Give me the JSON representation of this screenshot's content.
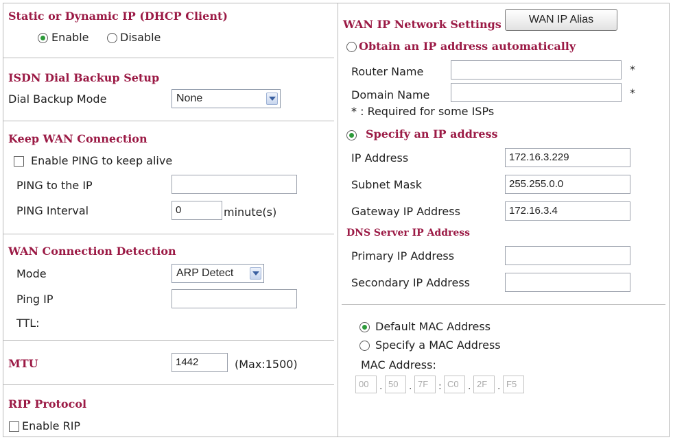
{
  "left": {
    "static_dynamic": {
      "title": "Static or Dynamic IP (DHCP Client)",
      "enable_label": "Enable",
      "disable_label": "Disable",
      "selected": "Enable"
    },
    "isdn": {
      "title": "ISDN Dial Backup Setup",
      "mode_label": "Dial Backup Mode",
      "mode_value": "None"
    },
    "keep_wan": {
      "title": "Keep WAN Connection",
      "ping_checkbox_label": "Enable PING to keep alive",
      "ping_ip_label": "PING to the IP",
      "ping_ip_value": "",
      "ping_interval_label": "PING Interval",
      "ping_interval_value": "0",
      "ping_interval_unit": "minute(s)"
    },
    "detection": {
      "title": "WAN Connection Detection",
      "mode_label": "Mode",
      "mode_value": "ARP Detect",
      "ping_ip_label": "Ping IP",
      "ping_ip_value": "",
      "ttl_label": "TTL:"
    },
    "mtu": {
      "title": "MTU",
      "value": "1442",
      "max_text": "(Max:1500)"
    },
    "rip": {
      "title": "RIP Protocol",
      "checkbox_label": "Enable RIP"
    }
  },
  "right": {
    "wan_ip": {
      "title": "WAN IP Network Settings",
      "alias_button": "WAN IP Alias"
    },
    "obtain": {
      "label": "Obtain an IP address automatically",
      "router_name_label": "Router Name",
      "router_name_value": "",
      "domain_name_label": "Domain Name",
      "domain_name_value": "",
      "required_mark": "*",
      "required_note": "* : Required for some ISPs"
    },
    "specify": {
      "label": "Specify an IP address",
      "ip_label": "IP Address",
      "ip_value": "172.16.3.229",
      "mask_label": "Subnet Mask",
      "mask_value": "255.255.0.0",
      "gateway_label": "Gateway IP Address",
      "gateway_value": "172.16.3.4"
    },
    "dns": {
      "title": "DNS Server IP Address",
      "primary_label": "Primary IP Address",
      "primary_value": "",
      "secondary_label": "Secondary IP Address",
      "secondary_value": ""
    },
    "mac": {
      "default_label": "Default MAC Address",
      "specify_label": "Specify a MAC Address",
      "address_label": "MAC Address:",
      "octets": [
        "00",
        "50",
        "7F",
        "C0",
        "2F",
        "F5"
      ],
      "separators": [
        ".",
        ".",
        ":",
        ".",
        "."
      ]
    }
  }
}
